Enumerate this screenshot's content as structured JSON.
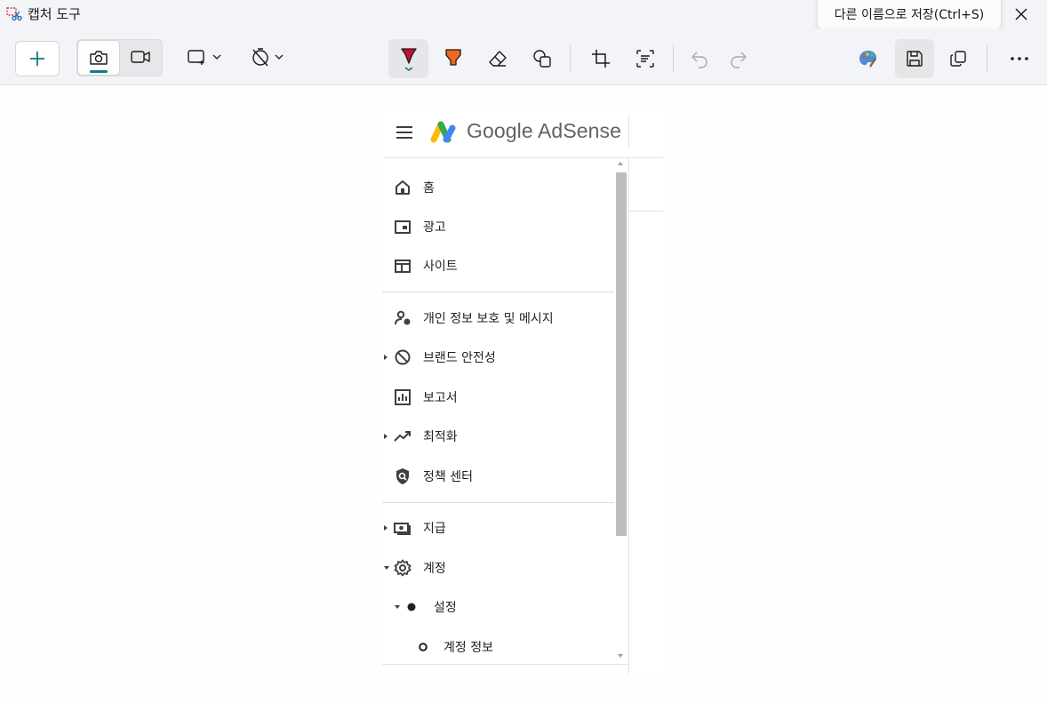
{
  "window": {
    "title": "캡처 도구",
    "tooltip": "다른 이름으로 저장(Ctrl+S)"
  },
  "toolbar": {
    "new": "plus-icon",
    "modes": [
      "camera-icon",
      "video-icon"
    ],
    "tools": [
      "rectangle-shape-icon",
      "timer-icon",
      "ballpoint-pen-icon",
      "highlighter-icon",
      "eraser-icon",
      "shapes-icon",
      "crop-icon",
      "text-actions-icon",
      "undo-icon",
      "redo-icon",
      "paint-icon",
      "save-icon",
      "copy-icon",
      "more-icon"
    ],
    "colors": {
      "accent": "#0f7a84",
      "pen": "#c8102e",
      "highlighter": "#f26522"
    }
  },
  "snip": {
    "brand": "Google AdSense",
    "brand_colors": [
      "#fbbc04",
      "#34a853",
      "#4285f4"
    ],
    "nav": [
      {
        "label": "홈",
        "icon": "home-icon"
      },
      {
        "label": "광고",
        "icon": "ads-icon"
      },
      {
        "label": "사이트",
        "icon": "sites-icon"
      },
      {
        "label": "개인 정보 보호 및 메시지",
        "icon": "privacy-messaging-icon"
      },
      {
        "label": "브랜드 안전성",
        "icon": "block-icon",
        "expander": "collapsed"
      },
      {
        "label": "보고서",
        "icon": "reports-icon"
      },
      {
        "label": "최적화",
        "icon": "trending-up-icon",
        "expander": "collapsed"
      },
      {
        "label": "정책 센터",
        "icon": "policy-shield-icon"
      },
      {
        "label": "지급",
        "icon": "payments-icon",
        "expander": "collapsed"
      },
      {
        "label": "계정",
        "icon": "settings-gear-icon",
        "expander": "expanded"
      },
      {
        "label": "설정",
        "icon": "filled-dot-icon",
        "expander": "expanded"
      },
      {
        "label": "계정 정보",
        "icon": "hollow-dot-icon"
      }
    ]
  }
}
